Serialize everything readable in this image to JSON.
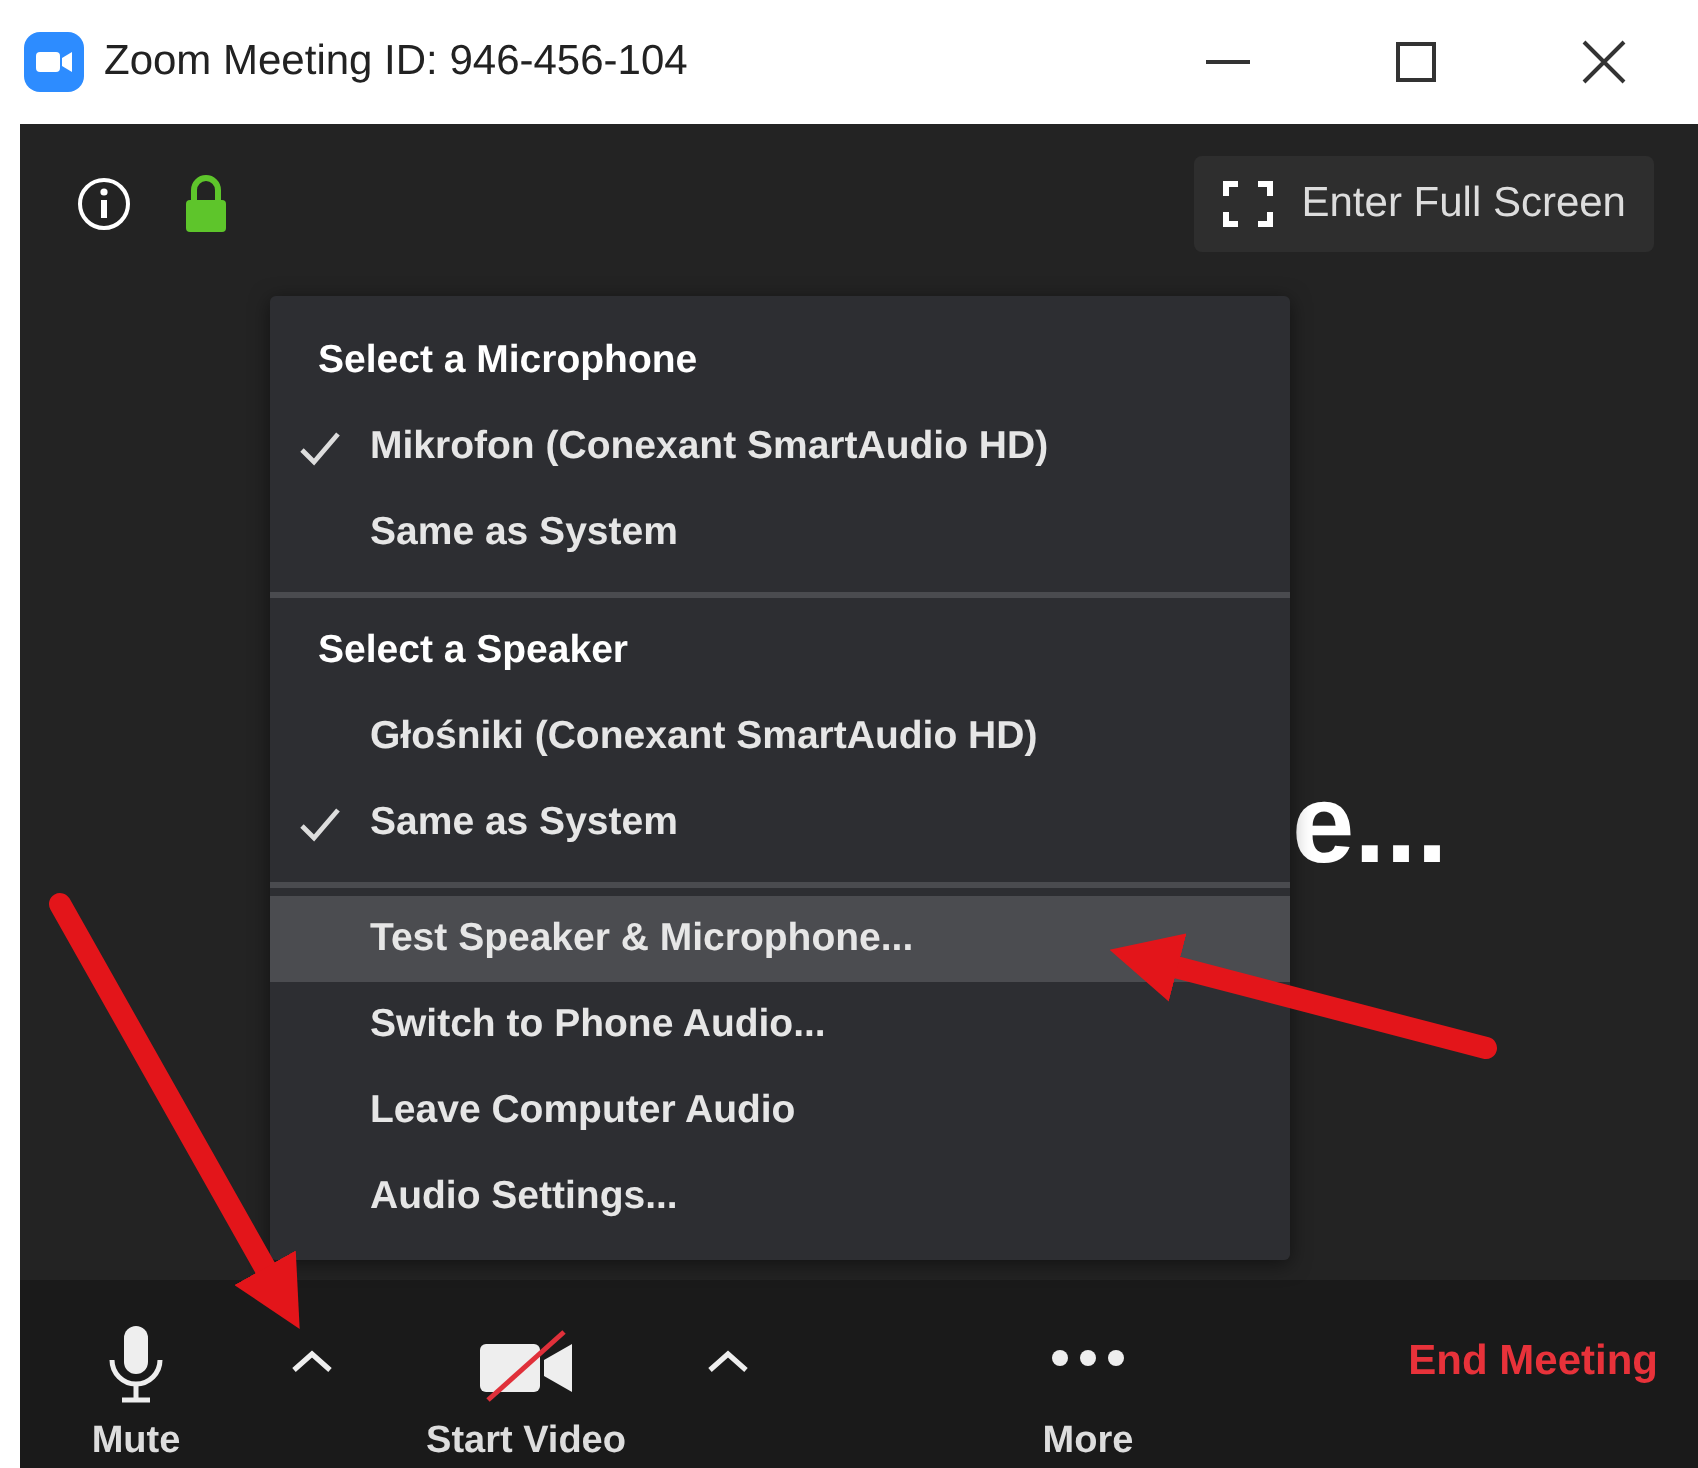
{
  "window": {
    "title": "Zoom Meeting ID: 946-456-104"
  },
  "top_bar": {
    "fullscreen_label": "Enter Full Screen"
  },
  "participant": {
    "name": "e..."
  },
  "audio_menu": {
    "sections": [
      {
        "title": "Select a Microphone",
        "items": [
          {
            "label": "Mikrofon (Conexant SmartAudio HD)",
            "checked": true
          },
          {
            "label": "Same as System",
            "checked": false
          }
        ]
      },
      {
        "title": "Select a Speaker",
        "items": [
          {
            "label": "Głośniki (Conexant SmartAudio HD)",
            "checked": false
          },
          {
            "label": "Same as System",
            "checked": true
          }
        ]
      },
      {
        "items": [
          {
            "label": "Test Speaker & Microphone...",
            "selected": true
          },
          {
            "label": "Switch to Phone Audio...",
            "selected": false
          },
          {
            "label": "Leave Computer Audio",
            "selected": false
          },
          {
            "label": "Audio Settings...",
            "selected": false
          }
        ]
      }
    ]
  },
  "toolbar": [
    {
      "kind": "mic",
      "label": "Mute"
    },
    {
      "kind": "caret"
    },
    {
      "kind": "video",
      "label": "Start Video"
    },
    {
      "kind": "caret"
    },
    {
      "kind": "more",
      "label": "More"
    },
    {
      "kind": "end",
      "label": "End Meeting"
    }
  ]
}
